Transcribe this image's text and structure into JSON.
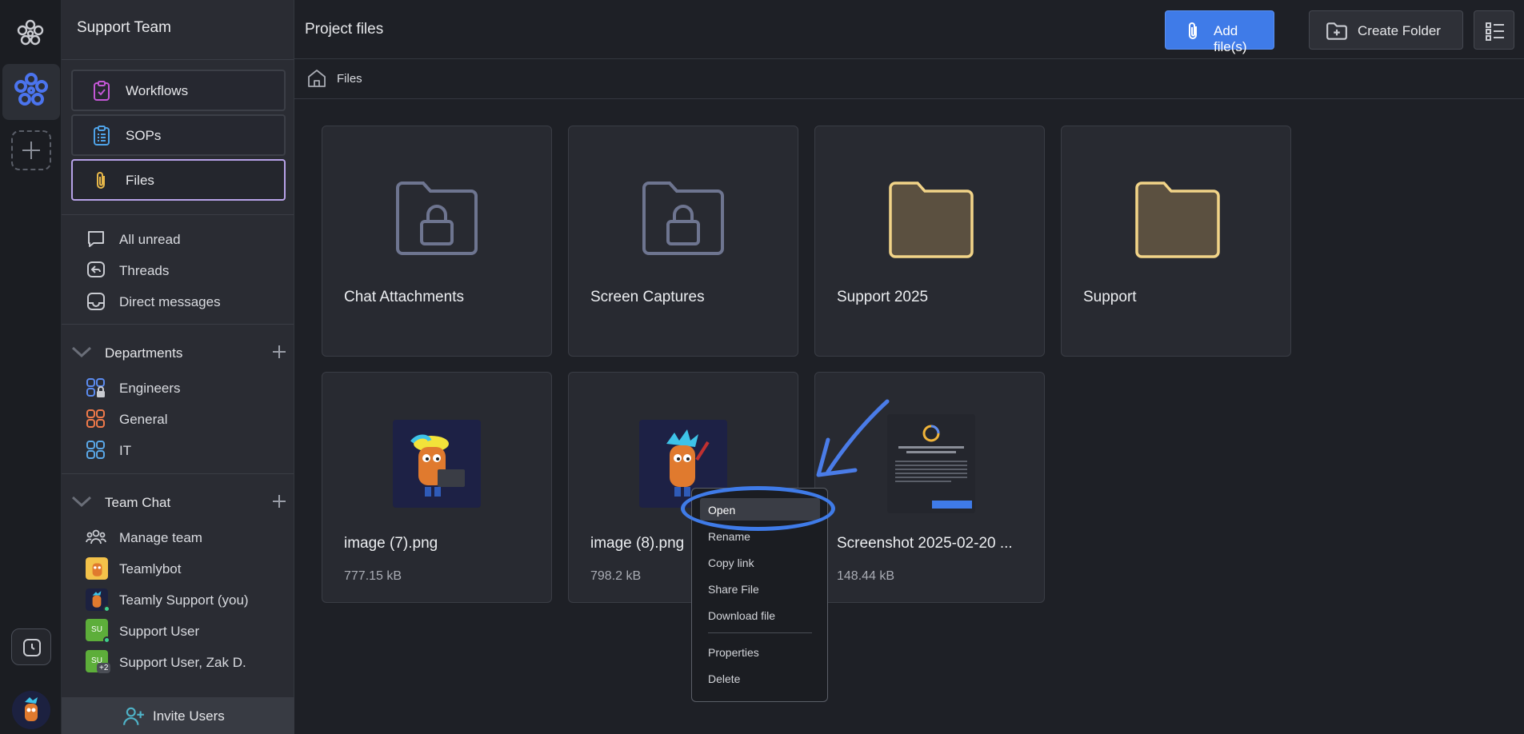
{
  "sidebar": {
    "team_name": "Support Team",
    "nav": [
      {
        "label": "Workflows",
        "icon": "clipboard-check-icon"
      },
      {
        "label": "SOPs",
        "icon": "clipboard-list-icon"
      },
      {
        "label": "Files",
        "icon": "paperclip-icon"
      }
    ],
    "quick": [
      {
        "label": "All unread",
        "icon": "chat-bubble-icon"
      },
      {
        "label": "Threads",
        "icon": "reply-icon"
      },
      {
        "label": "Direct messages",
        "icon": "inbox-icon"
      }
    ],
    "departments": {
      "label": "Departments",
      "items": [
        {
          "label": "Engineers",
          "icon": "grid-lock-icon",
          "color": "#5b8bf0"
        },
        {
          "label": "General",
          "icon": "grid-icon",
          "color": "#f07a4a"
        },
        {
          "label": "IT",
          "icon": "grid-icon",
          "color": "#5aa8e8"
        }
      ]
    },
    "team_chat": {
      "label": "Team Chat",
      "items": [
        {
          "label": "Manage team",
          "icon": "people-icon"
        },
        {
          "label": "Teamlybot",
          "icon": "bot-avatar"
        },
        {
          "label": "Teamly Support (you)",
          "icon": "user-avatar"
        },
        {
          "label": "Support User",
          "icon": "initials-avatar",
          "initials": "SU"
        },
        {
          "label": "Support User, Zak D.",
          "icon": "initials-avatar",
          "initials": "SU",
          "extra": "+2"
        }
      ]
    },
    "invite_label": "Invite Users"
  },
  "header": {
    "title": "Project files",
    "add_files_label": "Add file(s)",
    "create_folder_label": "Create Folder"
  },
  "breadcrumb": {
    "label": "Files"
  },
  "folders": [
    {
      "name": "Chat Attachments",
      "locked": true
    },
    {
      "name": "Screen Captures",
      "locked": true
    },
    {
      "name": "Support 2025",
      "locked": false
    },
    {
      "name": "Support",
      "locked": false
    }
  ],
  "files": [
    {
      "name": "image (7).png",
      "size": "777.15 kB"
    },
    {
      "name": "image (8).png",
      "size": "798.2 kB"
    },
    {
      "name": "Screenshot 2025-02-20 ...",
      "size": "148.44 kB"
    }
  ],
  "context_menu": {
    "items": [
      "Open",
      "Rename",
      "Copy link",
      "Share File",
      "Download file",
      "Properties",
      "Delete"
    ],
    "highlighted": "Open"
  },
  "colors": {
    "accent": "#3f7be8",
    "active_border": "#b7a2e8",
    "folder_fill": "#5b5040",
    "folder_stroke": "#f2d488"
  }
}
